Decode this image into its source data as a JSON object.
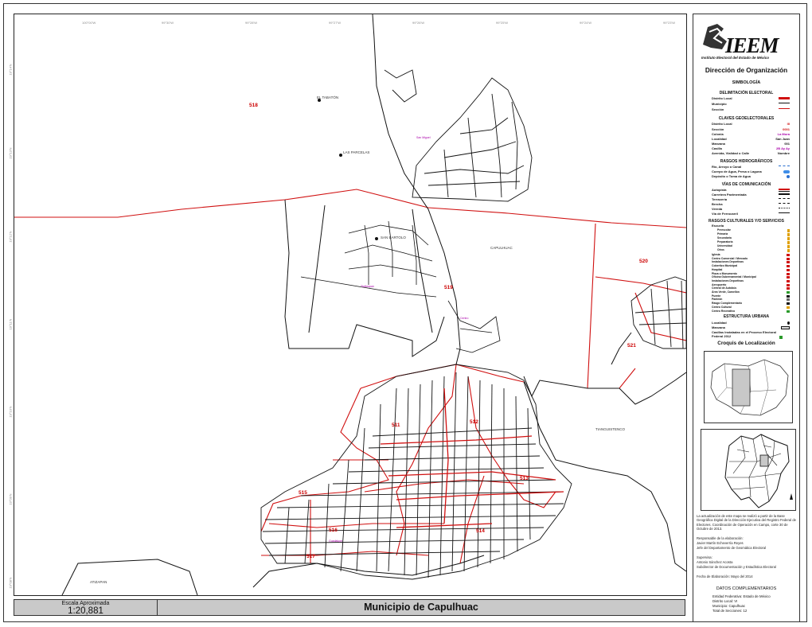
{
  "map": {
    "coords_top": [
      "100°00'W",
      "99°30'W",
      "99°28'W",
      "99°27'W",
      "99°26'W",
      "99°25'W",
      "99°24'W",
      "99°23'W"
    ],
    "coords_left": [
      "19°14'N",
      "19°13'N",
      "19°12'N",
      "19°11'N",
      "19°10'N",
      "19°09'N",
      "19°08'N"
    ],
    "locality_labels": {
      "el_tabaton": "EL TABATÓN",
      "las_parcelas": "LAS PARCELAS",
      "san_bartolo": "SAN BARTOLO",
      "capulhuac": "CAPULHUAC",
      "tianguistenco": "TIANGUISTENCO",
      "atizapan": "ATIZAPAN"
    },
    "section_labels": {
      "s518": "518",
      "s519": "519",
      "s520": "520",
      "s521": "521",
      "s511": "511",
      "s512": "512",
      "s513": "513",
      "s514": "514",
      "s515": "515",
      "s516": "516",
      "s517": "517"
    },
    "purple_labels": [
      "San Miguel",
      "Tlaltizapan",
      "Centro",
      "Guadalupe"
    ]
  },
  "panel": {
    "logo_text": "IEEM",
    "logo_subtitle": "Instituto Electoral del Estado de México",
    "department": "Dirección de Organización",
    "simbologia": "SIMBOLOGÍA",
    "sections": {
      "delimitacion": "DELIMITACIÓN ELECTORAL",
      "claves": "CLAVES GEOELECTORALES",
      "hidro": "RASGOS HIDROGRÁFICOS",
      "vias": "VÍAS DE COMUNICACIÓN",
      "culturales": "RASGOS CULTURALES Y/O SERVICIOS",
      "urbana": "ESTRUCTURA URBANA"
    },
    "delimitacion_items": [
      "Distrito Local",
      "Municipio",
      "Sección"
    ],
    "claves_items": [
      "Distrito Local",
      "Sección",
      "Colonia",
      "Localidad",
      "Manzana",
      "Casilla",
      "Avenida, Vialidad o Calle"
    ],
    "claves_samples": [
      "III",
      "0001",
      "La Mora",
      "San Juan",
      "001",
      "2B Ay Ay",
      "Nombre"
    ],
    "hidro_items": [
      "Río, Arroyo o Canal",
      "Cuerpo de Agua, Presa o Laguna",
      "Depósito o Toma de Agua"
    ],
    "vias_items": [
      "Autopista",
      "Carretera Pavimentada",
      "Terracería",
      "Brecha",
      "Vereda",
      "Vía de Ferrocarril"
    ],
    "escuela_title": "Escuela",
    "escuela_items": [
      "Preescolar",
      "Primaria",
      "Secundaria",
      "Preparatoria",
      "Universidad",
      "Otros"
    ],
    "culturales_items": [
      "Iglesia",
      "Centro Comercial / Mercado",
      "Instalaciones Deportivas",
      "Cobertizo Municipal",
      "Hospital",
      "Plaza o Monumento",
      "Oficina Gubernamental / Municipal",
      "Instalaciones Deportivas",
      "Aeropuerto",
      "Central de Autobús",
      "Área Verde, Camellón",
      "Puente",
      "Panteón",
      "Rasgo Complementario",
      "Centro Cultural",
      "Centro Recreativo"
    ],
    "urbana_items": [
      "Localidad",
      "Manzana",
      "Casillas Instaladas en el Proceso Electoral Federal 2012"
    ],
    "croquis": "Croquis de Localización",
    "note1": "La actualización de este mapa se realizó a partir de la Base Geográfica Digital de la Dirección Ejecutiva del Registro Federal de Electores. Coordinación de Operación en Campo, corte 30 de Octubre de 2013.",
    "note2": "Responsable de la elaboración:",
    "note3": "Javier Martín Echeverría Reyes",
    "note4": "Jefe del Departamento de Geomática Electoral",
    "note5": "Supervisa:",
    "note6": "Antonio Sánchez Acosta",
    "note7": "Subdirector de Documentación y Estadística Electoral",
    "note8": "Fecha de Elaboración: Mayo del 2014",
    "complementarios_title": "DATOS COMPLEMENTARIOS",
    "complementarios": [
      "Entidad Federativa: Estado de México",
      "Distrito Local: VI",
      "Municipio: Capulhuac",
      "Total de Secciones: 12"
    ]
  },
  "titlebar": {
    "scale_label": "Escala Aproximada",
    "scale_value": "1:20,881",
    "title": "Municipio de Capulhuac"
  },
  "colors": {
    "section_line": "#d01010",
    "street": "#111111",
    "panel_bg": "#ffffff",
    "titlebar_bg": "#c9c9c9"
  }
}
